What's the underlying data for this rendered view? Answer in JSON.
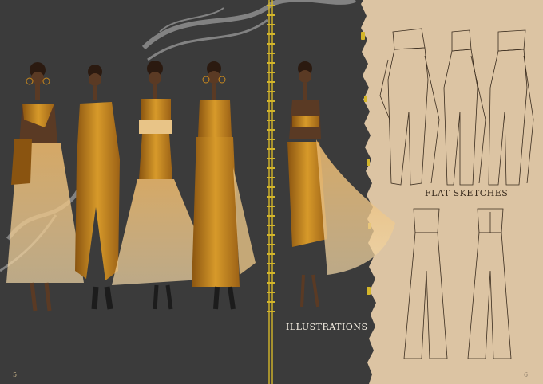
{
  "spread": {
    "left_page": {
      "caption": "ILLUSTRATIONS",
      "page_number": "5",
      "background": "#3b3b3b",
      "figures": [
        {
          "name": "figure-1-one-shoulder-tulle-gown"
        },
        {
          "name": "figure-2-asymmetric-jumpsuit"
        },
        {
          "name": "figure-3-fringe-tulle-dress"
        },
        {
          "name": "figure-4-corset-wide-leg-set"
        },
        {
          "name": "figure-5-draped-wing-skirt"
        }
      ]
    },
    "right_page": {
      "caption": "FLAT SKETCHES",
      "page_number": "6",
      "background": "#dcc4a3",
      "sketches": [
        {
          "name": "draped-jumpsuit-front"
        },
        {
          "name": "draped-jumpsuit-back"
        },
        {
          "name": "draped-jumpsuit-side"
        },
        {
          "name": "strapless-jumpsuit-front"
        },
        {
          "name": "strapless-jumpsuit-back"
        }
      ]
    },
    "colors": {
      "mustard": "#c9891e",
      "ochre_dark": "#8a5410",
      "tulle": "#e8c487",
      "skin": "#5a3a24",
      "zipper": "#d4b62a"
    }
  }
}
